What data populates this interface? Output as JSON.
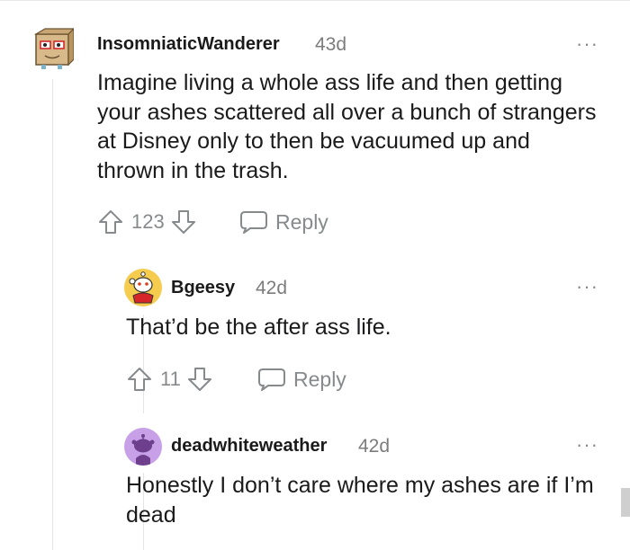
{
  "comments": [
    {
      "username": "InsomniaticWanderer",
      "time": "43d",
      "body": "Imagine living a whole ass life and then getting your ashes scattered all over a bunch of strangers at Disney only to then be vacuumed up and thrown in the trash.",
      "votes": "123",
      "reply_label": "Reply",
      "more_label": "···",
      "avatar_icon": "cardboard-box-avatar-icon"
    },
    {
      "username": "Bgeesy",
      "time": "42d",
      "body": "That’d be the after ass life.",
      "votes": "11",
      "reply_label": "Reply",
      "more_label": "···",
      "avatar_icon": "snoo-avatar-icon"
    },
    {
      "username": "deadwhiteweather",
      "time": "42d",
      "body": "Honestly I don’t care where my ashes are if I’m dead",
      "more_label": "···",
      "avatar_icon": "default-snoo-avatar-icon"
    }
  ],
  "colors": {
    "text": "#1a1a1b",
    "meta": "#7c7c7c",
    "icon": "#878a8c",
    "avatar3_bg": "#c7a0e8",
    "thread_line": "#e5e5e5"
  }
}
